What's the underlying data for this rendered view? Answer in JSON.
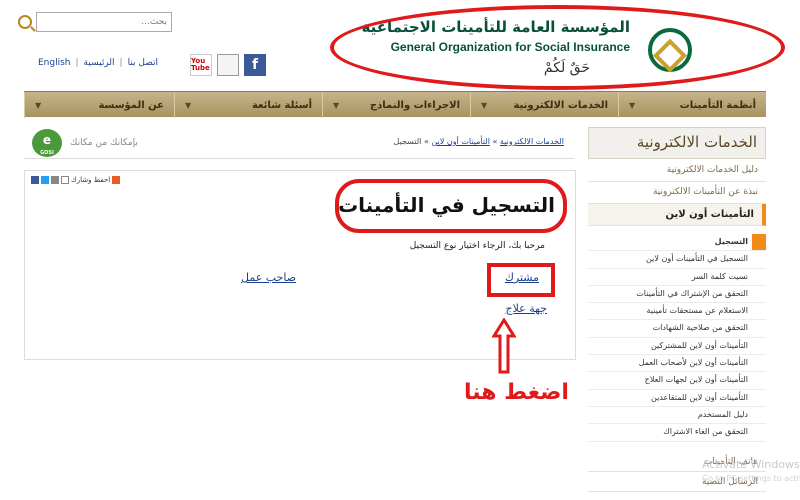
{
  "header": {
    "search_placeholder": "بحث...",
    "links": [
      "English",
      "|",
      "الرئيسية",
      "|",
      "اتصل بنا"
    ],
    "social": {
      "youtube_label": "You\nTube",
      "doc_label": "",
      "facebook_label": "f"
    },
    "logo": {
      "arabic": "المؤسسة العامة للتأمينات الاجتماعية",
      "english": "General Organization for Social Insurance",
      "slogan": "حَقٌ لَكُمْ"
    }
  },
  "nav": {
    "items": [
      {
        "label": "أنظمة التأمينات"
      },
      {
        "label": "الخدمات الالكترونية"
      },
      {
        "label": "الاجراءات والنماذج"
      },
      {
        "label": "أسئلة شائعة"
      },
      {
        "label": "عن المؤسسة"
      }
    ]
  },
  "sidebar": {
    "title": "الخدمات الالكترونية",
    "items": [
      "دليل الخدمات الالكترونية",
      "نبذة عن التأمينات الالكترونية",
      "التأمينات أون لاين"
    ],
    "sub_items": [
      "التسجيل",
      "التسجيل في التأمينات أون لاين",
      "نسيت كلمة السر",
      "التحقق من الإشتراك في التأمينات",
      "الاستعلام عن مستحقات تأمينية",
      "التحقق من صلاحية الشهادات",
      "التأمينات أون لاين للمشتركين",
      "التأمينات أون لاين لأصحاب العمل",
      "التأمينات أون لاين لجهات العلاج",
      "التأمينات أون لاين للمتقاعدين",
      "دليل المستخدم",
      "التحقق من الغاء الاشتراك"
    ],
    "tail_items": [
      "هاتف التأمينات",
      "الرسائل النصية"
    ]
  },
  "breadcrumb": {
    "part1": "الخدمات الالكترونية",
    "sep1": " » ",
    "part2": "التأمينات أون لاين",
    "sep2": " » ",
    "part3": "التسجيل"
  },
  "mobile_banner": {
    "badge_letter": "e",
    "badge_text": "GOSI",
    "text": "بإمكانك من مكانك"
  },
  "content": {
    "share_label": "احفظ وشارك",
    "title": "التسجيل في التأمينات",
    "welcome": "مرحبا بك، الرجاء اختيار نوع التسجيل",
    "options": {
      "subscriber": "مشترك",
      "employer": "صاحب عمل",
      "entity": "جهة علاج"
    },
    "press_here": "اضغط هنا"
  },
  "watermark": {
    "line1": "Activate Windows",
    "line2": "Go to PC settings to activate"
  },
  "colors": {
    "annotation_red": "#e01a1a",
    "nav_gold": "#b8a270",
    "brand_green": "#0a4f3c",
    "link_blue": "#1a3f8f",
    "accent_orange": "#f28a1a"
  }
}
